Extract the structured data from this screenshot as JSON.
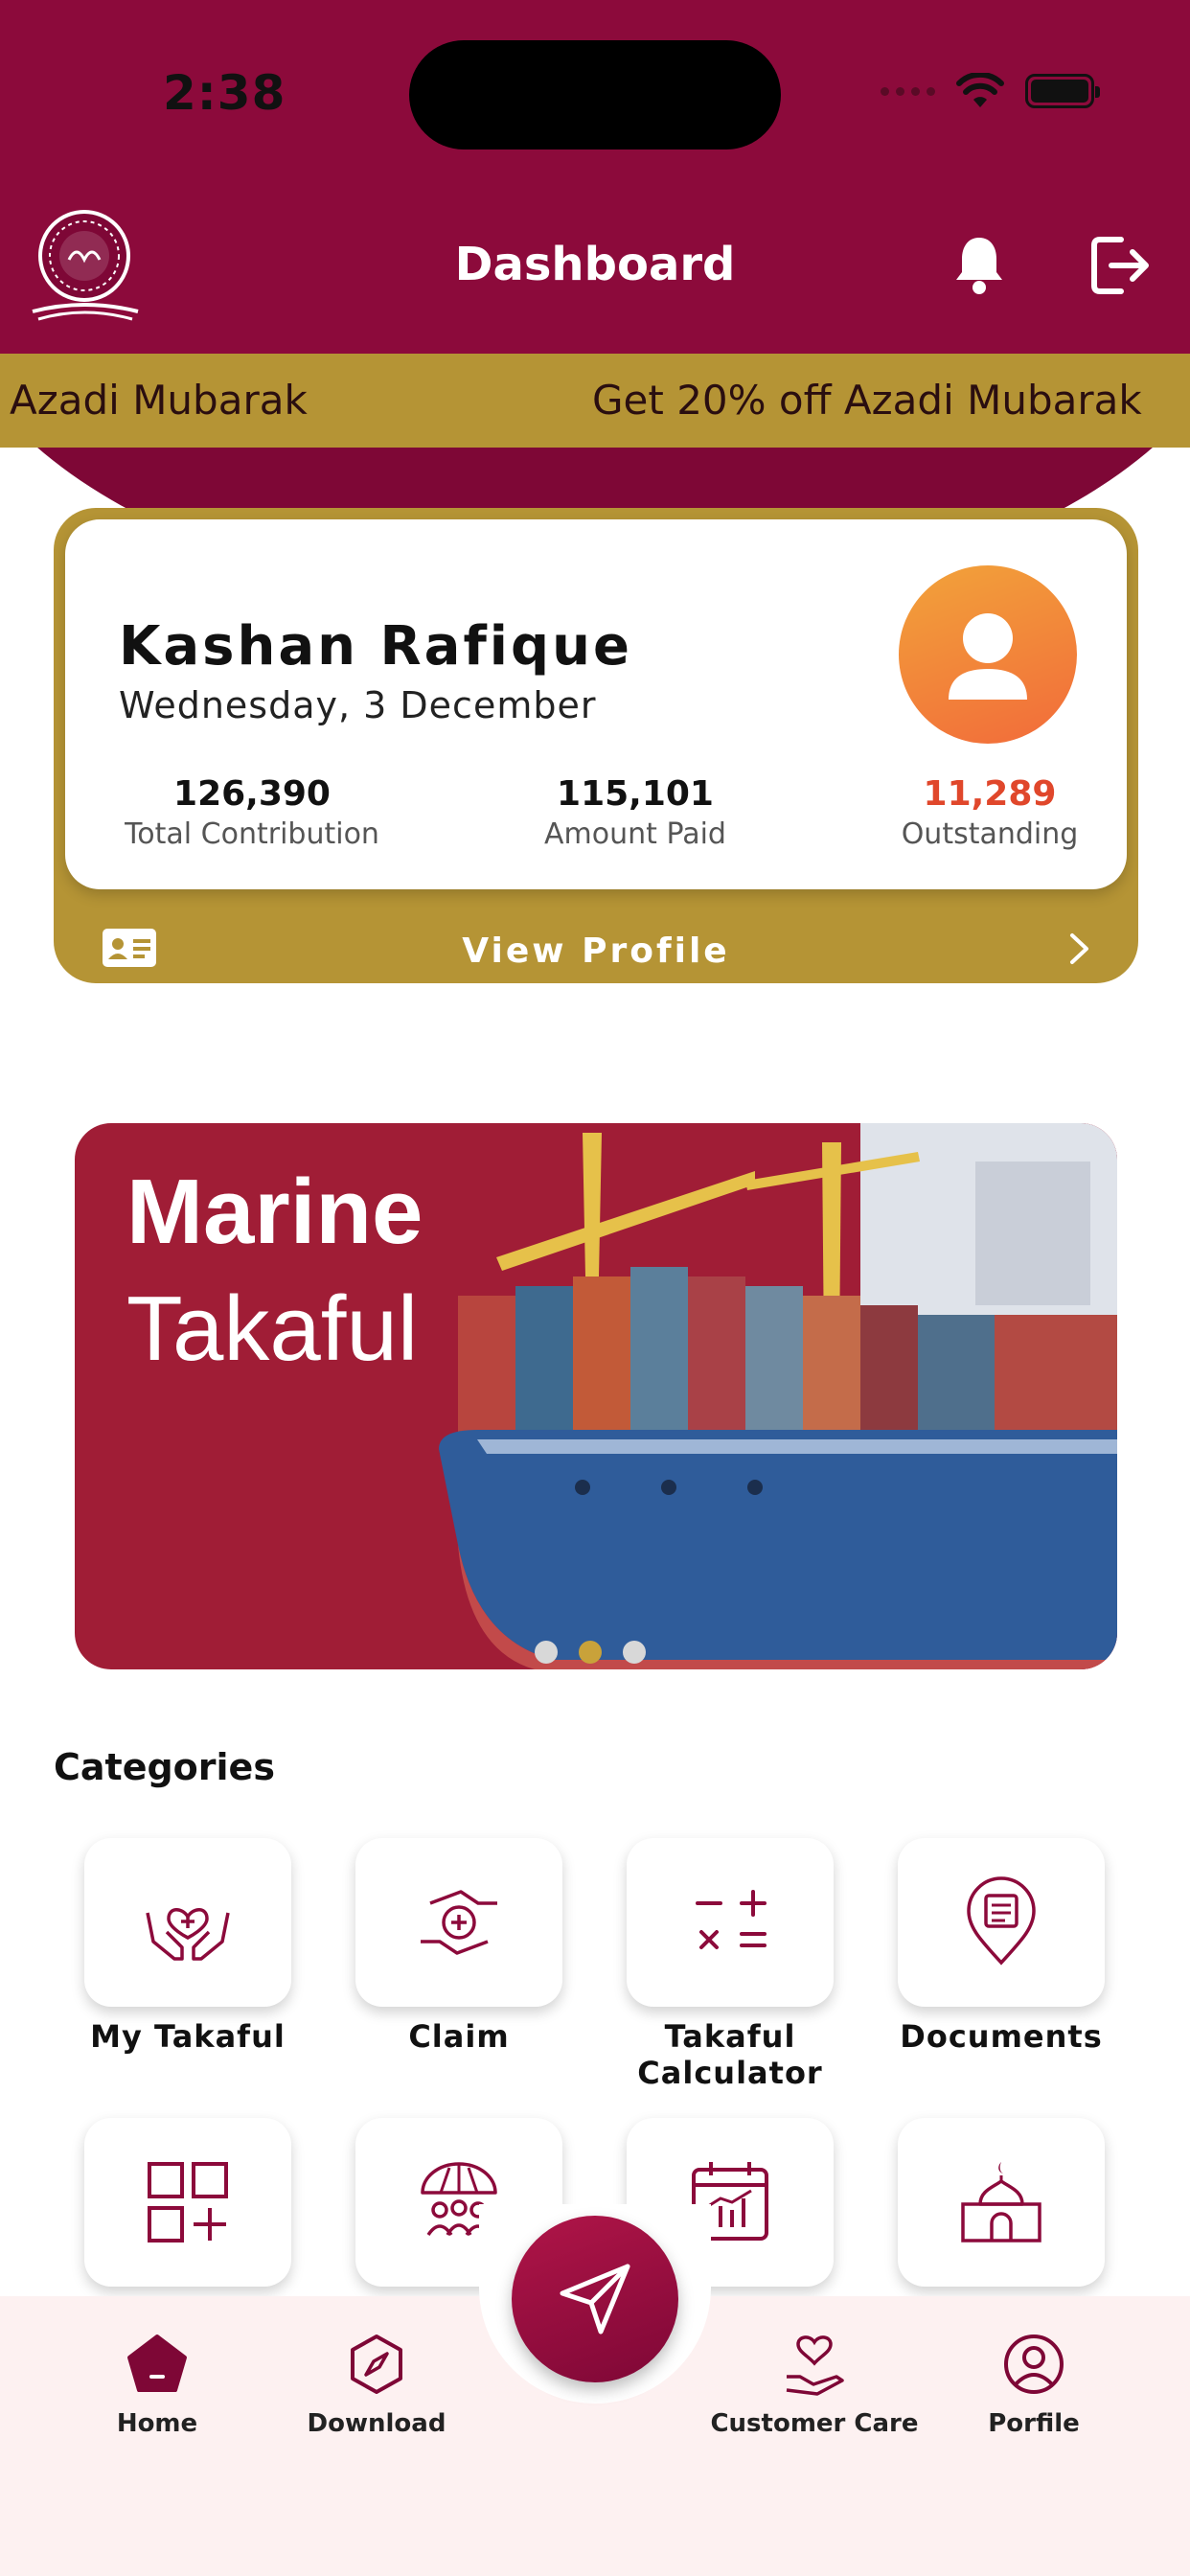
{
  "status_bar": {
    "time": "2:38"
  },
  "header": {
    "title": "Dashboard"
  },
  "marquee": {
    "items": [
      "Azadi Mubarak",
      "Get 20% off Azadi Mubarak"
    ]
  },
  "profile": {
    "name": "Kashan  Rafique",
    "date": "Wednesday, 3 December",
    "stats": [
      {
        "value": "126,390",
        "label": "Total Contribution"
      },
      {
        "value": "115,101",
        "label": "Amount Paid"
      },
      {
        "value": "11,289",
        "label": "Outstanding"
      }
    ],
    "view_profile_label": "View Profile"
  },
  "banner": {
    "title_line1": "Marine",
    "title_line2": "Takaful",
    "pages": 3,
    "active_page": 2
  },
  "categories": {
    "title": "Categories",
    "items": [
      {
        "label": "My Takaful",
        "icon": "heart-hands-icon"
      },
      {
        "label": "Claim",
        "icon": "claim-hands-icon"
      },
      {
        "label": "Takaful\nCalculator",
        "icon": "calculator-icon"
      },
      {
        "label": "Documents",
        "icon": "document-location-icon"
      },
      {
        "label": "",
        "icon": "add-grid-icon"
      },
      {
        "label": "",
        "icon": "family-umbrella-icon"
      },
      {
        "label": "",
        "icon": "calendar-chart-icon"
      },
      {
        "label": "",
        "icon": "mosque-icon"
      }
    ]
  },
  "bottom_nav": {
    "items": [
      {
        "label": "Home",
        "icon": "home-icon"
      },
      {
        "label": "Download",
        "icon": "download-icon"
      },
      {
        "label": "Customer Care",
        "icon": "customer-care-icon"
      },
      {
        "label": "Porfile",
        "icon": "profile-icon"
      }
    ],
    "fab_icon": "send-icon"
  },
  "colors": {
    "primary": "#8c0a3b",
    "gold": "#b59435",
    "outstanding": "#e0472b",
    "nav_bg": "#fdf1f1"
  }
}
